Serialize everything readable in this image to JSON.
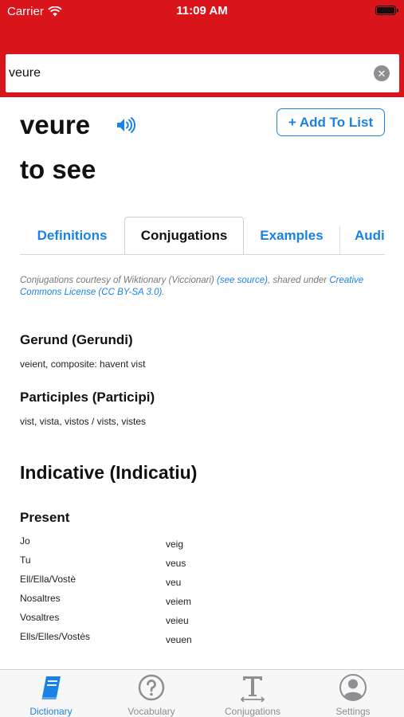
{
  "status_bar": {
    "carrier": "Carrier",
    "time": "11:09 AM"
  },
  "search": {
    "value": "veure"
  },
  "entry": {
    "word": "veure",
    "translation": "to see",
    "add_button": "+ Add To List"
  },
  "tabs": [
    {
      "label": "Definitions",
      "active": false
    },
    {
      "label": "Conjugations",
      "active": true
    },
    {
      "label": "Examples",
      "active": false
    },
    {
      "label": "Audio",
      "active": false
    }
  ],
  "credit": {
    "prefix": "Conjugations courtesy of Wiktionary (Viccionari) ",
    "source_link": "(see source)",
    "middle": ", shared under ",
    "license_link": "Creative Commons License (CC BY-SA 3.0)",
    "suffix": "."
  },
  "gerund": {
    "heading": "Gerund (Gerundi)",
    "text": "veient, composite: havent vist"
  },
  "participles": {
    "heading": "Participles (Participi)",
    "text": "vist, vista, vistos / vists, vistes"
  },
  "indicative": {
    "heading": "Indicative (Indicatiu)",
    "present": {
      "heading": "Present",
      "rows": [
        {
          "pronoun": "Jo",
          "form": "veig"
        },
        {
          "pronoun": "Tu",
          "form": "veus"
        },
        {
          "pronoun": "Ell/Ella/Vostè",
          "form": "veu"
        },
        {
          "pronoun": "Nosaltres",
          "form": "veiem"
        },
        {
          "pronoun": "Vosaltres",
          "form": "veieu"
        },
        {
          "pronoun": "Ells/Elles/Vostès",
          "form": "veuen"
        }
      ]
    }
  },
  "tab_bar": [
    {
      "label": "Dictionary",
      "icon": "book-icon",
      "active": true
    },
    {
      "label": "Vocabulary",
      "icon": "question-circle-icon",
      "active": false
    },
    {
      "label": "Conjugations",
      "icon": "text-size-icon",
      "active": false
    },
    {
      "label": "Settings",
      "icon": "user-circle-icon",
      "active": false
    }
  ],
  "colors": {
    "header": "#d9151b",
    "accent": "#1a82e6",
    "inactive": "#8e8e93"
  }
}
